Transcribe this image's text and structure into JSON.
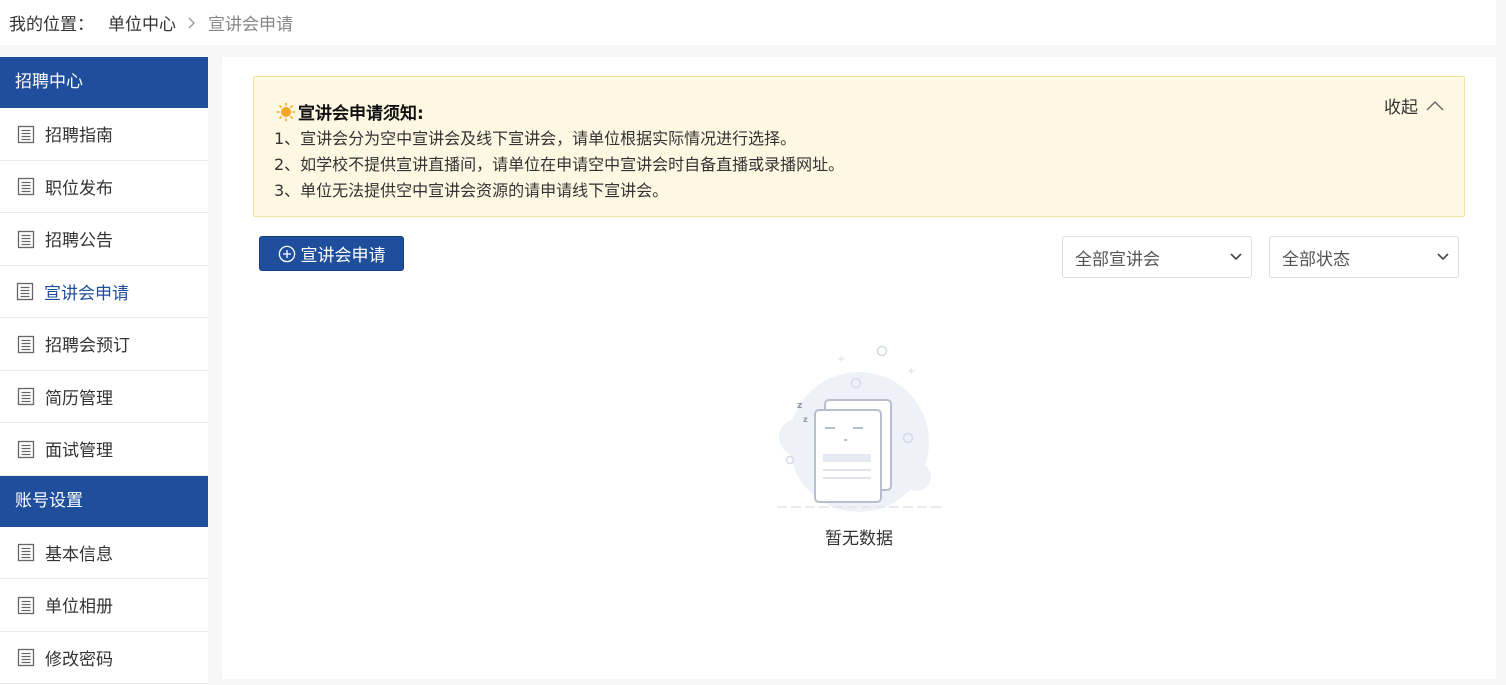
{
  "breadcrumb": {
    "label": "我的位置：",
    "parent": "单位中心",
    "current": "宣讲会申请"
  },
  "sidebar": {
    "sections": [
      {
        "title": "招聘中心",
        "items": [
          {
            "label": "招聘指南"
          },
          {
            "label": "职位发布"
          },
          {
            "label": "招聘公告"
          },
          {
            "label": "宣讲会申请"
          },
          {
            "label": "招聘会预订"
          },
          {
            "label": "简历管理"
          },
          {
            "label": "面试管理"
          }
        ]
      },
      {
        "title": "账号设置",
        "items": [
          {
            "label": "基本信息"
          },
          {
            "label": "单位相册"
          },
          {
            "label": "修改密码"
          }
        ]
      }
    ],
    "active_item": "宣讲会申请"
  },
  "notice": {
    "title": "宣讲会申请须知:",
    "lines": [
      "1、宣讲会分为空中宣讲会及线下宣讲会，请单位根据实际情况进行选择。",
      "2、如学校不提供宣讲直播间，请单位在申请空中宣讲会时自备直播或录播网址。",
      "3、单位无法提供空中宣讲会资源的请申请线下宣讲会。"
    ],
    "collapse_label": "收起"
  },
  "toolbar": {
    "apply_label": "宣讲会申请",
    "filter_type": "全部宣讲会",
    "filter_status": "全部状态"
  },
  "empty_state": {
    "text": "暂无数据"
  },
  "colors": {
    "primary": "#1f4f9c",
    "notice_bg": "#fef8e3",
    "notice_border": "#f6e3a3"
  }
}
